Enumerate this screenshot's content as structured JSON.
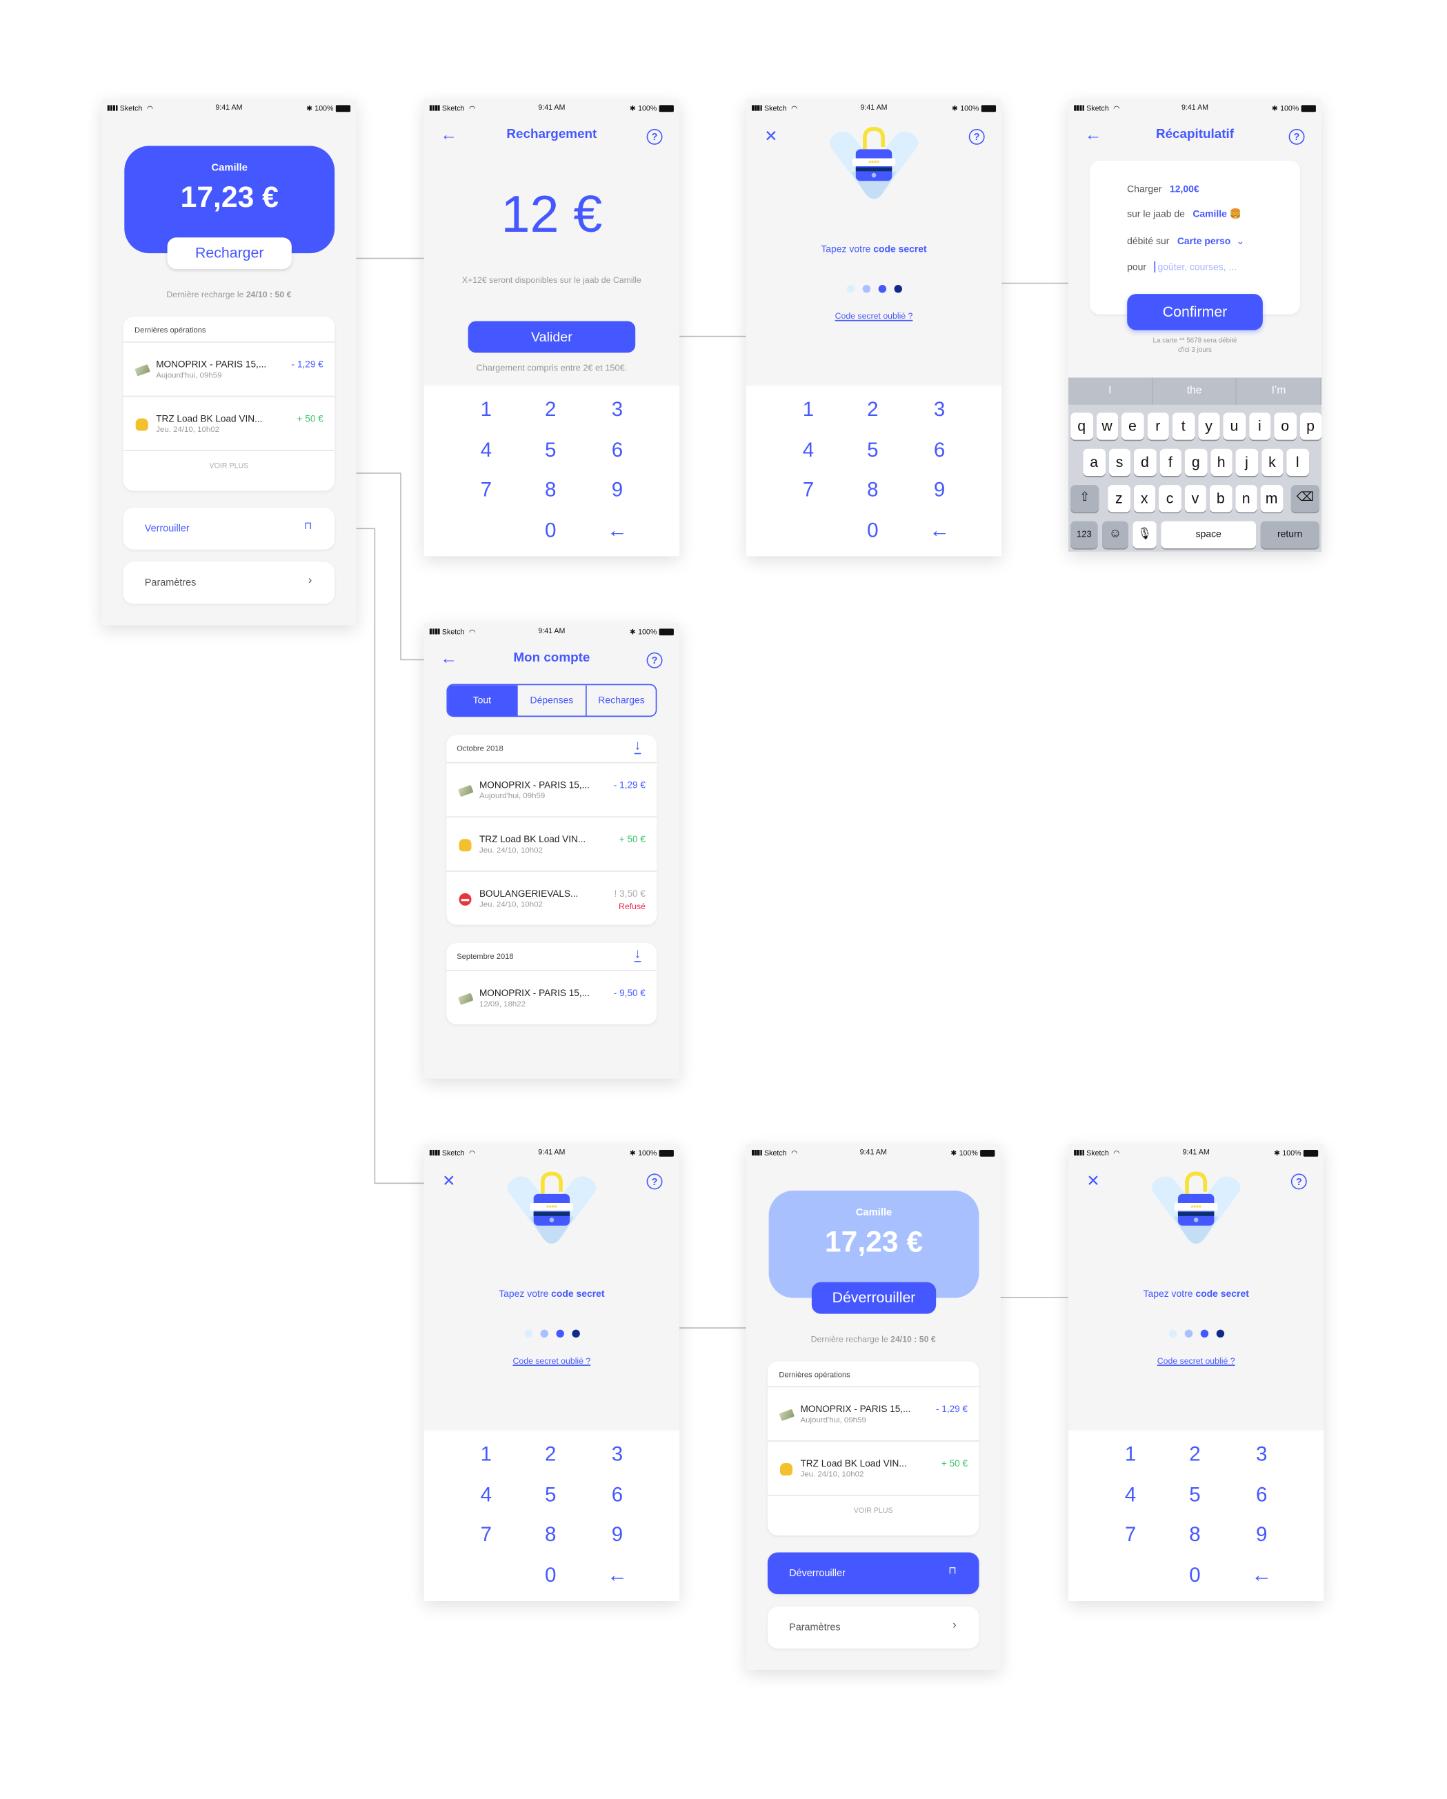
{
  "status": {
    "carrier": "Sketch",
    "time": "9:41 AM",
    "battery": "100%"
  },
  "colors": {
    "primary": "#4558ff",
    "primary_light": "#a9c0ff",
    "credit": "#3cc36b",
    "refused": "#e8284d",
    "background": "#f5f5f5"
  },
  "keypad": [
    "1",
    "2",
    "3",
    "4",
    "5",
    "6",
    "7",
    "8",
    "9",
    "",
    "0",
    "←"
  ],
  "home": {
    "name": "Camille",
    "balance": "17,23 €",
    "recharge_button": "Recharger",
    "last_recharge_prefix": "Dernière recharge le ",
    "last_recharge_value": "24/10 : 50 €",
    "ops_title": "Dernières opérations",
    "operations": [
      {
        "icon": "money-icon",
        "merchant": "MONOPRIX - PARIS 15,...",
        "date": "Aujourd'hui, 09h59",
        "amount": "- 1,29 €",
        "type": "debit"
      },
      {
        "icon": "thumbs-up-icon",
        "merchant": "TRZ Load BK Load VIN...",
        "date": "Jeu. 24/10, 10h02",
        "amount": "+ 50 €",
        "type": "credit"
      }
    ],
    "see_more": "VOIR PLUS",
    "lock_label": "Verrouiller",
    "settings_label": "Paramètres"
  },
  "locked_home": {
    "name": "Camille",
    "balance": "17,23 €",
    "unlock_button": "Déverrouiller",
    "last_recharge_prefix": "Dernière recharge le ",
    "last_recharge_value": "24/10 : 50 €",
    "ops_title": "Dernières opérations",
    "operations": [
      {
        "icon": "money-icon",
        "merchant": "MONOPRIX - PARIS 15,...",
        "date": "Aujourd'hui, 09h59",
        "amount": "- 1,29 €",
        "type": "debit"
      },
      {
        "icon": "thumbs-up-icon",
        "merchant": "TRZ Load BK Load VIN...",
        "date": "Jeu. 24/10, 10h02",
        "amount": "+ 50 €",
        "type": "credit"
      }
    ],
    "see_more": "VOIR PLUS",
    "unlock_label": "Déverrouiller",
    "settings_label": "Paramètres"
  },
  "recharge": {
    "title": "Rechargement",
    "amount": "12 €",
    "info": "X+12€ seront disponibles sur le jaab de Camille",
    "validate": "Valider",
    "range": "Chargement compris entre 2€ et 150€."
  },
  "code": {
    "prompt_prefix": "Tapez votre ",
    "prompt_bold": "code secret",
    "stars": "****",
    "dot_colors": [
      "#dcefff",
      "#a9c0ff",
      "#4558ff",
      "#102a8c"
    ],
    "forgot": "Code secret oublié ?"
  },
  "recap": {
    "title": "Récapitulatif",
    "rows": [
      {
        "label": "Charger",
        "value": "12,00€"
      },
      {
        "label": "sur le jaab de",
        "value": "Camille 🍔"
      },
      {
        "label": "débité sur",
        "value": "Carte perso"
      },
      {
        "label": "pour",
        "placeholder": "goûter, courses, ..."
      }
    ],
    "confirm": "Confirmer",
    "note_line1": "La carte ** 5678 sera débité",
    "note_line2": "d'ici 3 jours",
    "keyboard": {
      "suggestions": [
        "I",
        "the",
        "I’m"
      ],
      "row1": [
        "q",
        "w",
        "e",
        "r",
        "t",
        "y",
        "u",
        "i",
        "o",
        "p"
      ],
      "row2": [
        "a",
        "s",
        "d",
        "f",
        "g",
        "h",
        "j",
        "k",
        "l"
      ],
      "row3": [
        "z",
        "x",
        "c",
        "v",
        "b",
        "n",
        "m"
      ],
      "numbers": "123",
      "space": "space",
      "return": "return"
    }
  },
  "account": {
    "title": "Mon compte",
    "tabs": [
      "Tout",
      "Dépenses",
      "Recharges"
    ],
    "active_tab": "Tout",
    "months": [
      {
        "label": "Octobre 2018",
        "operations": [
          {
            "icon": "money-icon",
            "merchant": "MONOPRIX - PARIS 15,...",
            "date": "Aujourd'hui, 09h59",
            "amount": "- 1,29 €",
            "type": "debit"
          },
          {
            "icon": "thumbs-up-icon",
            "merchant": "TRZ Load BK Load VIN...",
            "date": "Jeu. 24/10, 10h02",
            "amount": "+ 50 €",
            "type": "credit"
          },
          {
            "icon": "no-entry-icon",
            "merchant": "BOULANGERIEVALS...",
            "date": "Jeu. 24/10, 10h02",
            "amount": "! 3,50 €",
            "type": "refused",
            "status": "Refusé"
          }
        ]
      },
      {
        "label": "Septembre 2018",
        "operations": [
          {
            "icon": "money-icon",
            "merchant": "MONOPRIX - PARIS 15,...",
            "date": "12/09, 18h22",
            "amount": "- 9,50 €",
            "type": "debit"
          }
        ]
      }
    ]
  }
}
